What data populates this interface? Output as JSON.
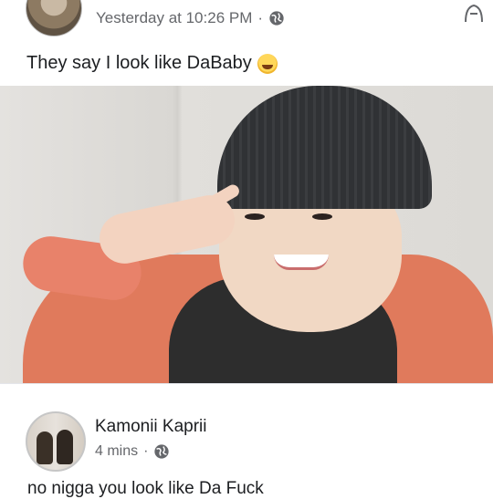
{
  "post": {
    "timestamp": "Yesterday at 10:26 PM",
    "separator": "·",
    "caption": "They say I look like DaBaby",
    "icons": {
      "privacy": "globe-icon",
      "emoji": "laughing-emoji-icon",
      "menu": "more-options-icon"
    }
  },
  "comment": {
    "author": "Kamonii Kaprii",
    "time": "4 mins",
    "separator": "·",
    "text": "no nigga you look like Da Fuck"
  },
  "colors": {
    "meta_text": "#65676b",
    "body_text": "#1c1e21",
    "jacket": "#e07a5c",
    "beanie": "#303235"
  }
}
